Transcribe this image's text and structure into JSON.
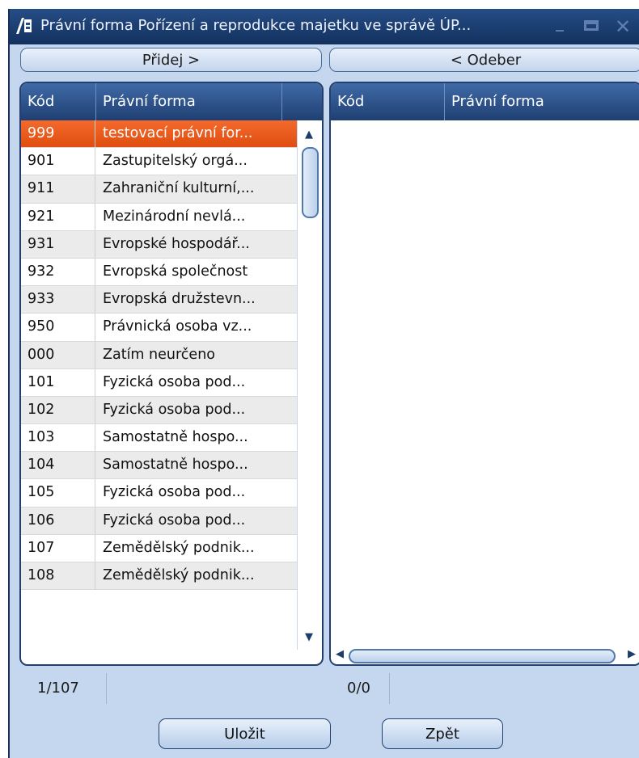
{
  "window": {
    "title": "Právní forma Pořízení a reprodukce majetku ve správě ÚP...",
    "colors": {
      "titlebar": "#12315e",
      "background": "#c5d7ee",
      "selected_row": "#f0591c"
    }
  },
  "actions": {
    "add_label": "Přidej  >",
    "remove_label": "<  Odeber"
  },
  "left_grid": {
    "columns": [
      "Kód",
      "Právní forma"
    ],
    "rows": [
      {
        "code": "999",
        "name": "testovací právní for...",
        "selected": true
      },
      {
        "code": "901",
        "name": "Zastupitelský orgá..."
      },
      {
        "code": "911",
        "name": "Zahraniční kulturní,..."
      },
      {
        "code": "921",
        "name": "Mezinárodní nevlá..."
      },
      {
        "code": "931",
        "name": "Evropské hospodář..."
      },
      {
        "code": "932",
        "name": "Evropská společnost"
      },
      {
        "code": "933",
        "name": "Evropská družstevn..."
      },
      {
        "code": "950",
        "name": "Právnická osoba vz..."
      },
      {
        "code": "000",
        "name": "Zatím neurčeno"
      },
      {
        "code": "101",
        "name": "Fyzická osoba pod..."
      },
      {
        "code": "102",
        "name": "Fyzická osoba pod..."
      },
      {
        "code": "103",
        "name": "Samostatně hospo..."
      },
      {
        "code": "104",
        "name": "Samostatně hospo..."
      },
      {
        "code": "105",
        "name": "Fyzická osoba pod..."
      },
      {
        "code": "106",
        "name": "Fyzická osoba pod..."
      },
      {
        "code": "107",
        "name": "Zemědělský podnik..."
      },
      {
        "code": "108",
        "name": "Zemědělský podnik..."
      }
    ],
    "status": "1/107"
  },
  "right_grid": {
    "columns": [
      "Kód",
      "Právní forma"
    ],
    "rows": [],
    "status": "0/0"
  },
  "footer": {
    "save_label": "Uložit",
    "back_label": "Zpět"
  }
}
